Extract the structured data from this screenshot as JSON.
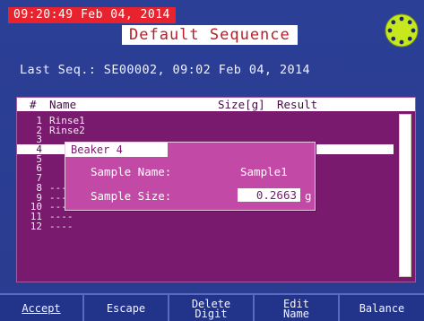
{
  "header": {
    "clock": "09:20:49 Feb 04, 2014",
    "title": "Default Sequence",
    "last_sequence": "Last Seq.: SE00002, 09:02 Feb 04, 2014"
  },
  "list": {
    "columns": [
      "#",
      "Name",
      "Size[g]",
      "Result"
    ],
    "rows": [
      {
        "num": "1",
        "name": "Rinse1"
      },
      {
        "num": "2",
        "name": "Rinse2"
      },
      {
        "num": "3",
        "name": ""
      },
      {
        "num": "4",
        "name": ""
      },
      {
        "num": "5",
        "name": ""
      },
      {
        "num": "6",
        "name": ""
      },
      {
        "num": "7",
        "name": ""
      },
      {
        "num": "8",
        "name": "----"
      },
      {
        "num": "9",
        "name": "----"
      },
      {
        "num": "10",
        "name": "----"
      },
      {
        "num": "11",
        "name": "----"
      },
      {
        "num": "12",
        "name": "----"
      }
    ],
    "selected_index": 3
  },
  "dialog": {
    "title": "Beaker 4",
    "sample_name_label": "Sample Name:",
    "sample_name_value": "Sample1",
    "sample_size_label": "Sample Size:",
    "sample_size_value": "0.2663",
    "sample_size_unit": "g"
  },
  "softkeys": {
    "accept": "Accept",
    "escape": "Escape",
    "delete_digit": "Delete\nDigit",
    "edit_name": "Edit\nName",
    "balance": "Balance"
  },
  "colors": {
    "background": "#2b3f96",
    "clock_bg": "#e8232e",
    "list_bg": "#7a1a6f",
    "dialog_bg": "#c24aa6",
    "status_light": "#c8e81e"
  }
}
